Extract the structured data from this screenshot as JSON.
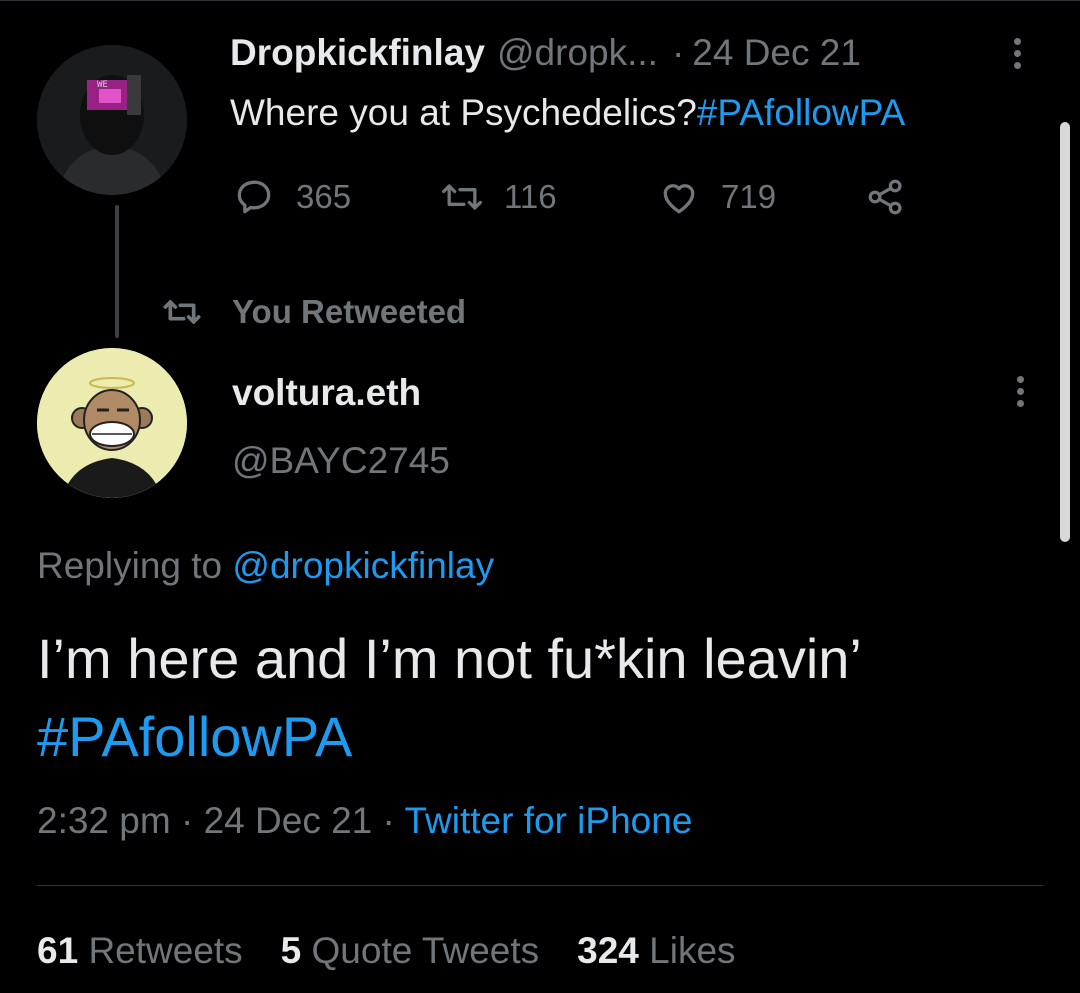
{
  "parent_tweet": {
    "name": "Dropkickfinlay",
    "handle": "@dropk...",
    "separator": "·",
    "date": "24 Dec 21",
    "text": "Where you at Psychedelics?",
    "hashtag": "#PAfollowPA",
    "replies": "365",
    "retweets": "116",
    "likes": "719"
  },
  "retweet_context": {
    "label": "You Retweeted"
  },
  "reply_tweet": {
    "name": "voltura.eth",
    "handle": "@BAYC2745",
    "replying_prefix": "Replying to ",
    "replying_to": "@dropkickfinlay",
    "text": "I’m here and I’m not fu*kin leavin’",
    "hashtag": "#PAfollowPA",
    "time": "2:32 pm",
    "sep1": " · ",
    "date": "24 Dec 21",
    "sep2": " · ",
    "source": "Twitter for iPhone"
  },
  "stats": {
    "retweets_count": "61",
    "retweets_label": "Retweets",
    "quotes_count": "5",
    "quotes_label": "Quote Tweets",
    "likes_count": "324",
    "likes_label": "Likes"
  },
  "colors": {
    "background": "#000000",
    "text_primary": "#e7e9ea",
    "text_secondary": "#71767b",
    "link": "#1d9bf0"
  }
}
